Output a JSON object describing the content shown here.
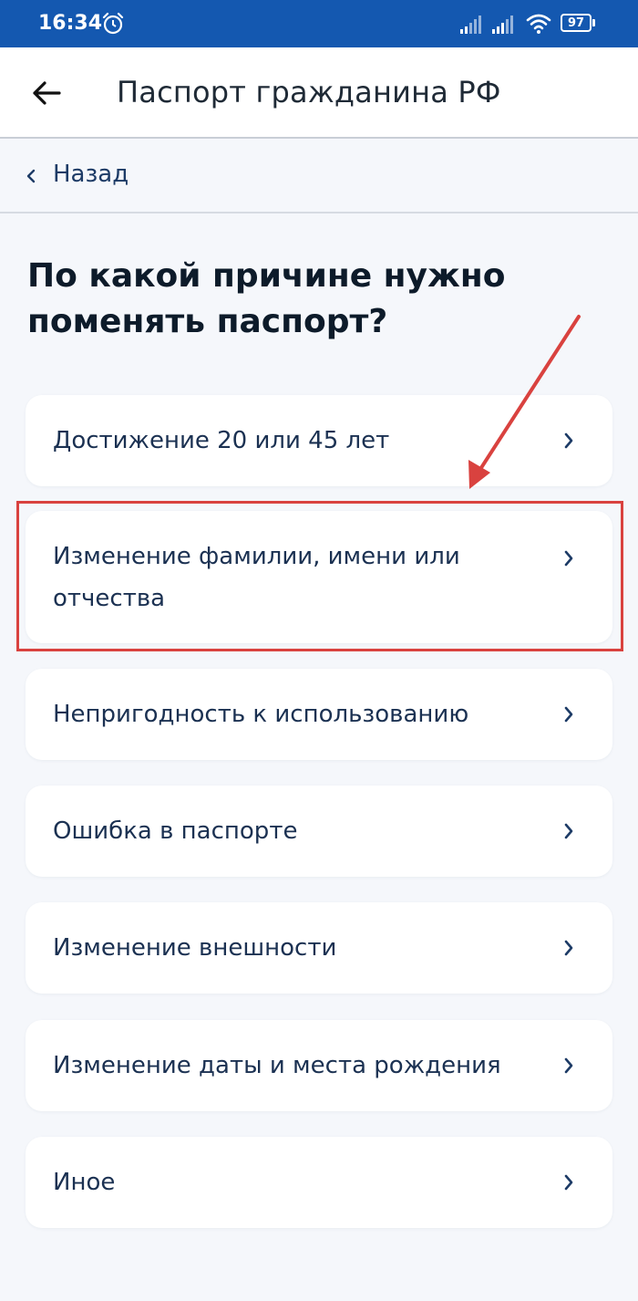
{
  "status_bar": {
    "time": "16:34",
    "alarm_icon": "alarm-clock-icon",
    "signal_icon": "cellular-signal-icon",
    "wifi_icon": "wifi-icon",
    "battery_percent": "97"
  },
  "header": {
    "title": "Паспорт гражданина РФ",
    "back_icon": "arrow-left-icon"
  },
  "back_link": {
    "label": "Назад"
  },
  "question": "По какой причине нужно поменять паспорт?",
  "options": [
    {
      "label": "Достижение 20 или 45 лет"
    },
    {
      "label": "Изменение фамилии, имени или отчества"
    },
    {
      "label": "Непригодность к использованию"
    },
    {
      "label": "Ошибка в паспорте"
    },
    {
      "label": "Изменение внешности"
    },
    {
      "label": "Изменение даты и места рождения"
    },
    {
      "label": "Иное"
    }
  ],
  "annotation": {
    "highlighted_option": "Изменение фамилии, имени или отчества",
    "color": "#d9423f"
  },
  "colors": {
    "status_bar": "#1458b0",
    "background": "#f5f7fb",
    "text_primary": "#0d1b2a",
    "option_text": "#1b3152",
    "chevron": "#1d3b66"
  }
}
